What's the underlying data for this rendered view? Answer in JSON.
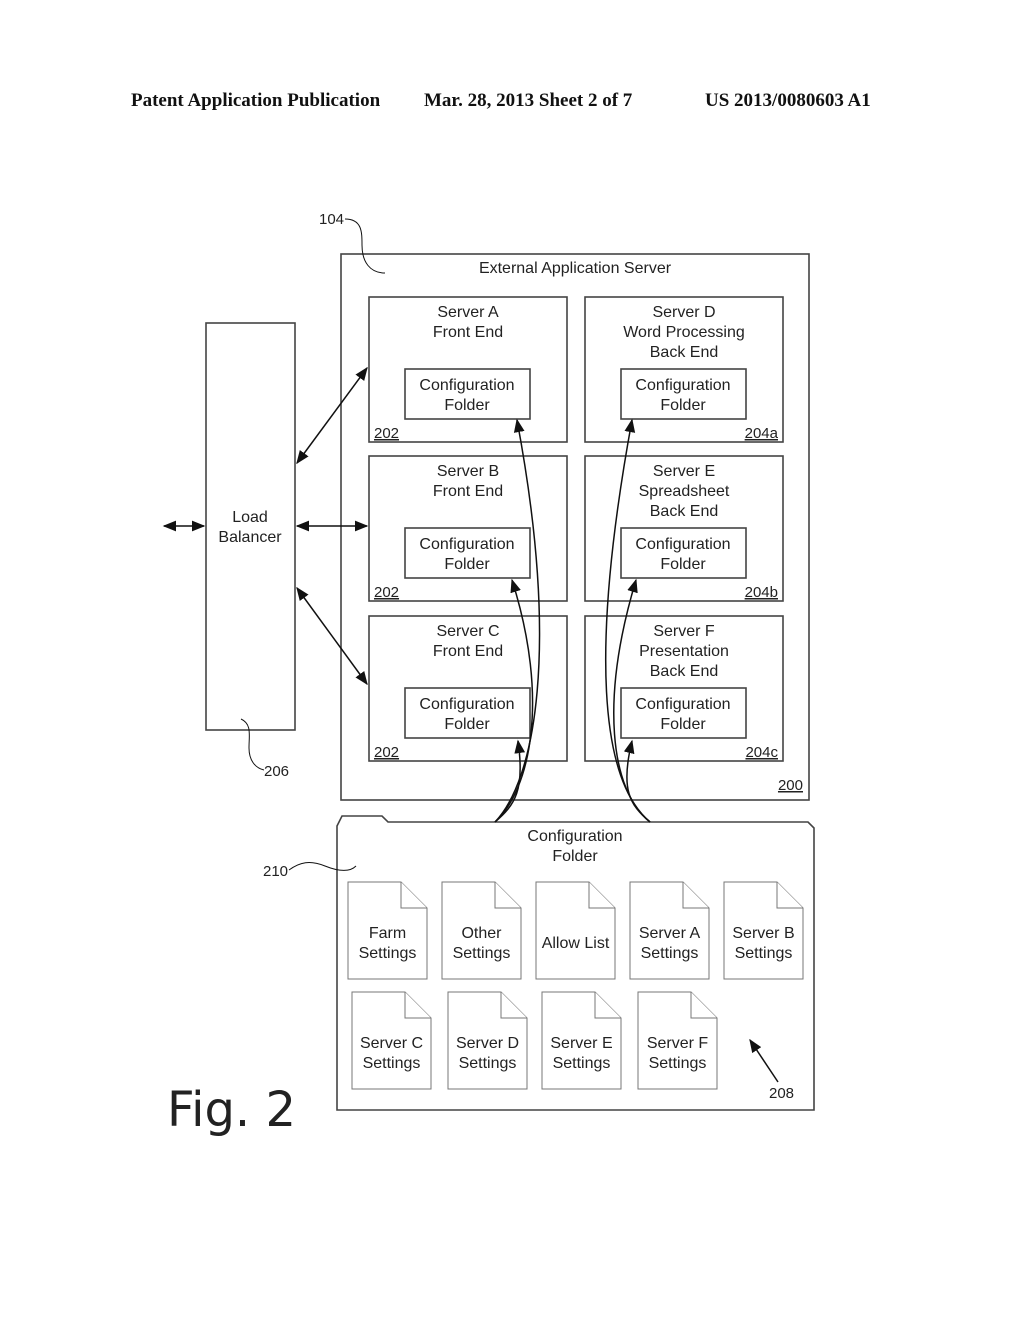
{
  "header": {
    "left": "Patent Application Publication",
    "center": "Mar. 28, 2013  Sheet 2 of 7",
    "right": "US 2013/0080603 A1"
  },
  "figure_label": "Fig. 2",
  "external_server": {
    "title": "External Application Server",
    "ref": "104",
    "inner_ref": "200"
  },
  "load_balancer": {
    "label_line1": "Load",
    "label_line2": "Balancer",
    "ref": "206"
  },
  "servers": [
    {
      "lines": [
        "Server A",
        "Front End"
      ],
      "folder": [
        "Configuration",
        "Folder"
      ],
      "ref": "202"
    },
    {
      "lines": [
        "Server B",
        "Front End"
      ],
      "folder": [
        "Configuration",
        "Folder"
      ],
      "ref": "202"
    },
    {
      "lines": [
        "Server C",
        "Front End"
      ],
      "folder": [
        "Configuration",
        "Folder"
      ],
      "ref": "202"
    },
    {
      "lines": [
        "Server D",
        "Word Processing",
        "Back End"
      ],
      "folder": [
        "Configuration",
        "Folder"
      ],
      "ref": "204a"
    },
    {
      "lines": [
        "Server E",
        "Spreadsheet",
        "Back End"
      ],
      "folder": [
        "Configuration",
        "Folder"
      ],
      "ref": "204b"
    },
    {
      "lines": [
        "Server F",
        "Presentation",
        "Back End"
      ],
      "folder": [
        "Configuration",
        "Folder"
      ],
      "ref": "204c"
    }
  ],
  "config_folder": {
    "title_line1": "Configuration",
    "title_line2": "Folder",
    "ref": "210",
    "docs_ref": "208",
    "documents": [
      [
        "Farm",
        "Settings"
      ],
      [
        "Other",
        "Settings"
      ],
      [
        "Allow List"
      ],
      [
        "Server A",
        "Settings"
      ],
      [
        "Server B",
        "Settings"
      ],
      [
        "Server C",
        "Settings"
      ],
      [
        "Server D",
        "Settings"
      ],
      [
        "Server E",
        "Settings"
      ],
      [
        "Server F",
        "Settings"
      ]
    ]
  }
}
